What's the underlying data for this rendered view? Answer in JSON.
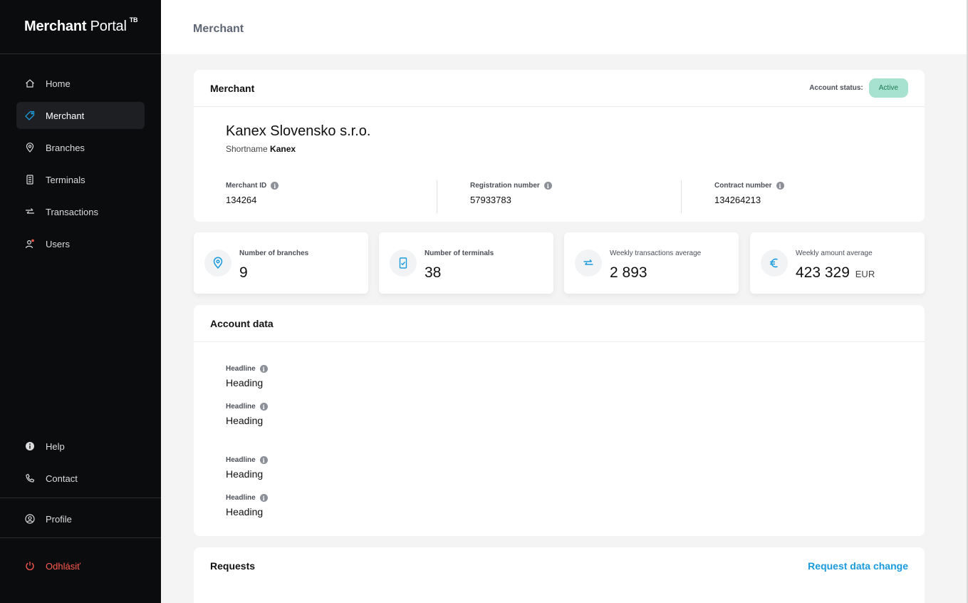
{
  "sidebar": {
    "brand_bold": "Merchant",
    "brand_light": "Portal",
    "brand_sup": "TB",
    "items": [
      {
        "label": "Home",
        "icon": "home-icon"
      },
      {
        "label": "Merchant",
        "icon": "tag-icon",
        "active": true
      },
      {
        "label": "Branches",
        "icon": "location-pin-icon"
      },
      {
        "label": "Terminals",
        "icon": "terminal-icon"
      },
      {
        "label": "Transactions",
        "icon": "transfer-arrows-icon"
      },
      {
        "label": "Users",
        "icon": "users-icon"
      }
    ],
    "help": "Help",
    "contact": "Contact",
    "profile": "Profile",
    "logout": "Odhlásiť"
  },
  "header": {
    "title": "Merchant"
  },
  "merchant_card": {
    "title": "Merchant",
    "status_label": "Account status:",
    "status_value": "Active",
    "name": "Kanex Slovensko s.r.o.",
    "shortname_label": "Shortname",
    "shortname_value": "Kanex",
    "fields": [
      {
        "label": "Merchant ID",
        "value": "134264"
      },
      {
        "label": "Registration number",
        "value": "57933783"
      },
      {
        "label": "Contract number",
        "value": "134264213"
      }
    ]
  },
  "stats": [
    {
      "label": "Number of branches",
      "value": "9",
      "unit": "",
      "icon": "location-pin-icon"
    },
    {
      "label": "Number of terminals",
      "value": "38",
      "unit": "",
      "icon": "terminal-icon"
    },
    {
      "label": "Weekly transactions average",
      "value": "2 893",
      "unit": "",
      "icon": "transfer-arrows-icon"
    },
    {
      "label": "Weekly amount average",
      "value": "423 329",
      "unit": "EUR",
      "icon": "euro-icon"
    }
  ],
  "account_card": {
    "title": "Account data",
    "fields": [
      {
        "label": "Headline",
        "value": "Heading"
      },
      {
        "label": "Headline",
        "value": "Heading"
      },
      {
        "label": "Headline",
        "value": "Heading"
      },
      {
        "label": "Headline",
        "value": "Heading"
      }
    ]
  },
  "requests_card": {
    "title": "Requests",
    "action": "Request data change"
  },
  "colors": {
    "accent": "#1a9bdc",
    "status_bg": "#a7e1cf",
    "logout": "#ff5a4f",
    "sidebar_bg": "#0b0c0e"
  }
}
